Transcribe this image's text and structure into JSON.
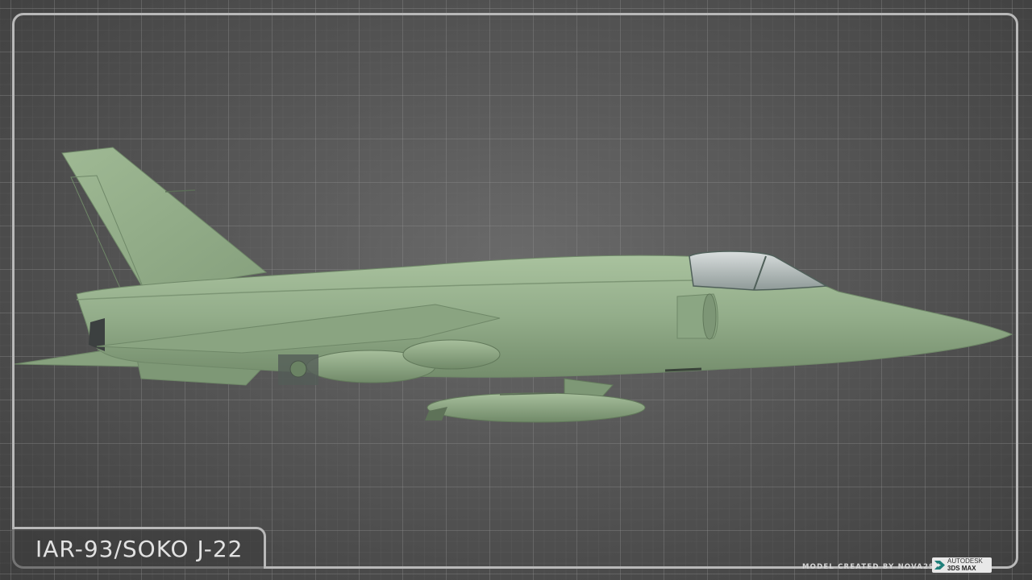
{
  "title": "IAR-93/SOKO J-22",
  "credit": "MODEL CREATED BY NOVA29R",
  "software_badge": {
    "line1": "AUTODESK",
    "line2": "3DS MAX",
    "icon": "3ds-max-logo-icon"
  },
  "colors": {
    "aircraft_green": "#93ad8a",
    "frame": "#b9b9b9",
    "background": "#565656"
  }
}
